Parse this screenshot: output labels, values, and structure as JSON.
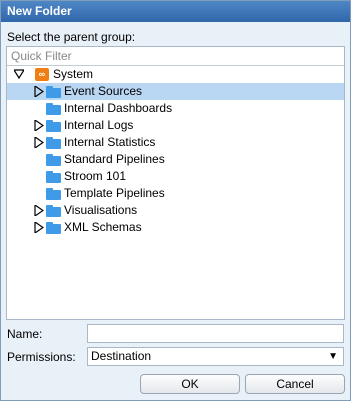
{
  "dialog": {
    "title": "New Folder",
    "prompt": "Select the parent group:"
  },
  "filter": {
    "placeholder": "Quick Filter"
  },
  "tree": {
    "root": {
      "label": "System",
      "icon": "stroom-logo-icon",
      "expanded": true
    },
    "items": [
      {
        "label": "Event Sources",
        "expandable": true,
        "selected": true
      },
      {
        "label": "Internal Dashboards",
        "expandable": false
      },
      {
        "label": "Internal Logs",
        "expandable": true
      },
      {
        "label": "Internal Statistics",
        "expandable": true
      },
      {
        "label": "Standard Pipelines",
        "expandable": false
      },
      {
        "label": "Stroom 101",
        "expandable": false
      },
      {
        "label": "Template Pipelines",
        "expandable": false
      },
      {
        "label": "Visualisations",
        "expandable": true
      },
      {
        "label": "XML Schemas",
        "expandable": true
      }
    ]
  },
  "form": {
    "name_label": "Name:",
    "name_value": "",
    "permissions_label": "Permissions:",
    "permissions_value": "Destination"
  },
  "buttons": {
    "ok": "OK",
    "cancel": "Cancel"
  },
  "colors": {
    "folder": "#3f9be8",
    "selection": "#b9d6f3",
    "title_bar": "#3a73b8",
    "logo": "#f07f13"
  }
}
